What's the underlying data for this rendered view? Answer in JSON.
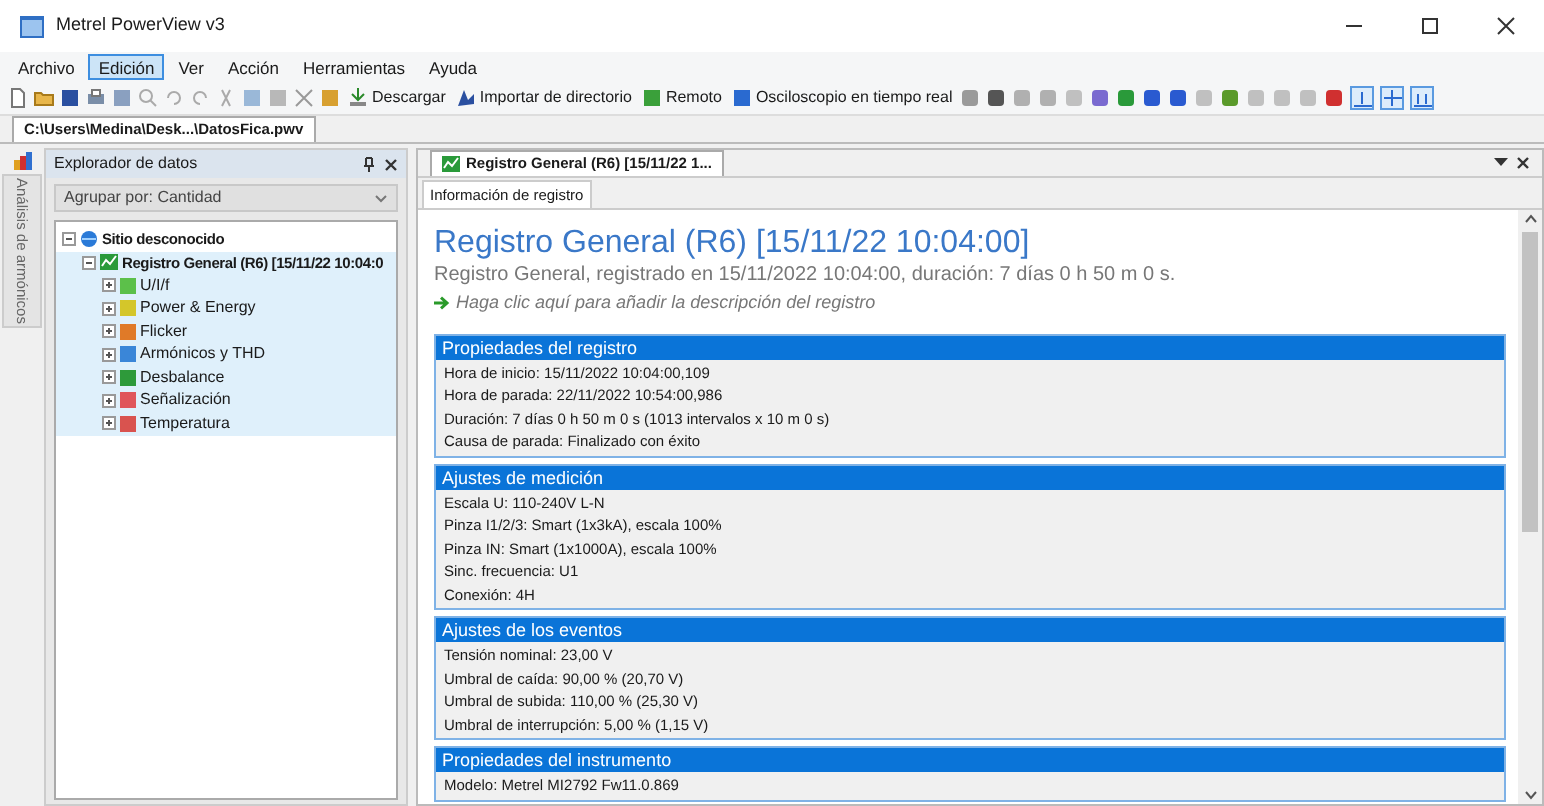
{
  "window": {
    "title": "Metrel PowerView v3"
  },
  "menu": [
    {
      "label": "Archivo",
      "selected": false
    },
    {
      "label": "Edición",
      "selected": true
    },
    {
      "label": "Ver",
      "selected": false
    },
    {
      "label": "Acción",
      "selected": false
    },
    {
      "label": "Herramientas",
      "selected": false
    },
    {
      "label": "Ayuda",
      "selected": false
    }
  ],
  "toolbar": {
    "buttons": [
      "Descargar",
      "Importar de directorio",
      "Remoto",
      "Osciloscopio en tiempo real"
    ]
  },
  "document_tabs": [
    {
      "label": "C:\\Users\\Medina\\Desk...\\DatosFica.pwv",
      "selected": true
    }
  ],
  "side_strip": {
    "label": "Análisis de armónicos"
  },
  "explorer": {
    "title": "Explorador de datos",
    "group_by": "Agrupar por: Cantidad",
    "tree": [
      {
        "label": "Sitio desconocido",
        "expanded": true,
        "selected": false,
        "children": [
          {
            "label": "Registro General (R6) [15/11/22 10:04:0",
            "expanded": true,
            "selected": true,
            "children": [
              {
                "label": "U/I/f",
                "color": "#5cc04a",
                "selected": true
              },
              {
                "label": "Power & Energy",
                "color": "#d4c62a",
                "selected": true
              },
              {
                "label": "Flicker",
                "color": "#e07a28",
                "selected": true
              },
              {
                "label": "Armónicos y THD",
                "color": "#3a86d8",
                "selected": true
              },
              {
                "label": "Desbalance",
                "color": "#2e9a3a",
                "selected": true
              },
              {
                "label": "Señalización",
                "color": "#e0555a",
                "selected": true
              },
              {
                "label": "Temperatura",
                "color": "#d9534f",
                "selected": true
              }
            ]
          }
        ]
      }
    ]
  },
  "record_tabs": [
    {
      "label": "Registro General (R6) [15/11/22 1...",
      "selected": true
    }
  ],
  "sub_tabs": [
    {
      "label": "Información de registro",
      "selected": true
    }
  ],
  "record": {
    "title": "Registro General (R6) [15/11/22 10:04:00]",
    "subtitle": "Registro General, registrado en 15/11/2022 10:04:00, duración: 7 días 0 h 50 m 0 s.",
    "description_link": "Haga clic aquí para añadir la descripción del registro",
    "sections": [
      {
        "title": "Propiedades del registro",
        "lines": [
          "Hora de inicio: 15/11/2022 10:04:00,109",
          "Hora de parada: 22/11/2022 10:54:00,986",
          "Duración: 7 días 0 h 50 m 0 s (1013 intervalos x 10 m 0 s)",
          "Causa de parada: Finalizado con éxito"
        ]
      },
      {
        "title": "Ajustes de medición",
        "lines": [
          "Escala U: 110-240V L-N",
          "Pinza I1/2/3: Smart (1x3kA), escala 100%",
          "Pinza IN: Smart (1x1000A), escala 100%",
          "Sinc. frecuencia: U1",
          "Conexión: 4H"
        ]
      },
      {
        "title": "Ajustes de los eventos",
        "lines": [
          "Tensión nominal: 23,00 V",
          "Umbral de caída: 90,00 % (20,70 V)",
          "Umbral de subida: 110,00 % (25,30 V)",
          "Umbral de interrupción: 5,00 % (1,15 V)"
        ]
      },
      {
        "title": "Propiedades del instrumento",
        "lines": [
          "Modelo: Metrel MI2792 Fw11.0.869"
        ]
      }
    ]
  }
}
